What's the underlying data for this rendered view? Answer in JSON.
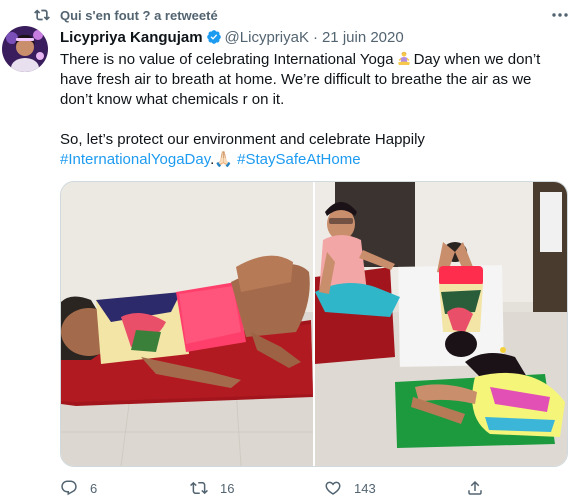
{
  "retweet_context": {
    "text": "Qui s'en fout ? a retweeté",
    "icon": "retweet-icon"
  },
  "tweet": {
    "author_name": "Licypriya Kangujam",
    "handle": "@LicypriyaK",
    "separator": "·",
    "date": "21 juin 2020",
    "verified": true,
    "text_line1_a": "There is no value of celebrating International Yoga",
    "text_line1_b": "Day when we don’t have fresh air to breath at home. We’re difficult to breathe the air as we don’t know what chemicals r on it.",
    "text_para2": "So, let’s protect our environment and celebrate Happily",
    "hashtag1": "#InternationalYogaDay",
    "hashtag1_suffix": ".🙏🏻",
    "hashtag2": "#StaySafeAtHome"
  },
  "actions": {
    "reply_count": "6",
    "retweet_count": "16",
    "like_count": "143"
  },
  "colors": {
    "accent": "#1d9bf0",
    "muted": "#536471",
    "text": "#0f1419"
  }
}
